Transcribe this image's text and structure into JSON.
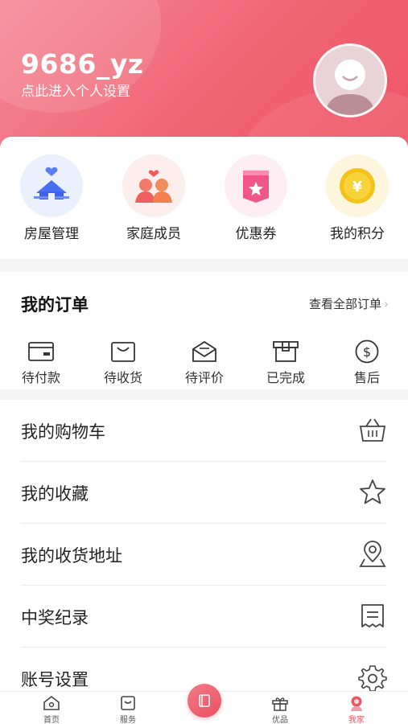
{
  "profile": {
    "username": "9686_yz",
    "subtitle": "点此进入个人设置"
  },
  "quick_actions": [
    {
      "label": "房屋管理",
      "icon": "house-icon"
    },
    {
      "label": "家庭成员",
      "icon": "family-icon"
    },
    {
      "label": "优惠券",
      "icon": "coupon-icon"
    },
    {
      "label": "我的积分",
      "icon": "points-coin-icon"
    }
  ],
  "orders": {
    "title": "我的订单",
    "view_all": "查看全部订单",
    "statuses": [
      {
        "label": "待付款",
        "icon": "wallet-icon"
      },
      {
        "label": "待收货",
        "icon": "shopping-bag-icon"
      },
      {
        "label": "待评价",
        "icon": "envelope-icon"
      },
      {
        "label": "已完成",
        "icon": "box-icon"
      },
      {
        "label": "售后",
        "icon": "dollar-circle-icon"
      }
    ]
  },
  "menu": [
    {
      "label": "我的购物车",
      "icon": "basket-icon"
    },
    {
      "label": "我的收藏",
      "icon": "star-icon"
    },
    {
      "label": "我的收货地址",
      "icon": "location-pin-icon"
    },
    {
      "label": "中奖纪录",
      "icon": "receipt-icon"
    },
    {
      "label": "账号设置",
      "icon": "gear-icon"
    }
  ],
  "tabbar": {
    "items": [
      {
        "label": "首页",
        "icon": "home-icon"
      },
      {
        "label": "服务",
        "icon": "service-icon"
      },
      {
        "label": "优品",
        "icon": "gift-icon"
      },
      {
        "label": "我家",
        "icon": "profile-icon"
      }
    ],
    "active": "我家"
  },
  "colors": {
    "accent": "#ee5565",
    "header_gradient_start": "#f58a97",
    "coin": "#f5c21a"
  }
}
